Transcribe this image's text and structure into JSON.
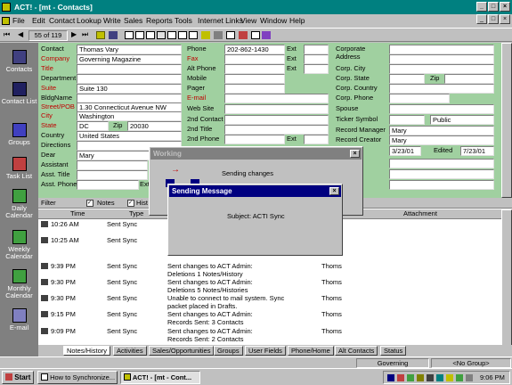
{
  "window": {
    "title": "ACT! - [mt - Contacts]",
    "min": "_",
    "max": "□",
    "close": "×"
  },
  "menu": [
    "File",
    "Edit",
    "Contact",
    "Lookup",
    "Write",
    "Sales",
    "Reports",
    "Tools",
    "Internet Links",
    "View",
    "Window",
    "Help"
  ],
  "toolbar": {
    "record_counter": "55 of 119"
  },
  "sidebar": [
    "Contacts",
    "Contact List",
    "Groups",
    "Task List",
    "Daily Calendar",
    "Weekly Calendar",
    "Monthly Calendar",
    "E-mail"
  ],
  "contact": {
    "labels": {
      "contact": "Contact",
      "company": "Company",
      "title": "Title",
      "department": "Department",
      "suite": "Suite",
      "bldgname": "BldgName",
      "street": "Street/POB",
      "city": "City",
      "state": "State",
      "zip": "Zip",
      "country": "Country",
      "directions": "Directions",
      "dear": "Dear",
      "assistant": "Assistant",
      "asst_title": "Asst. Title",
      "asst_phone": "Asst. Phone",
      "ext": "Ext",
      "phone": "Phone",
      "fax": "Fax",
      "alt_phone": "Alt Phone",
      "mobile": "Mobile",
      "pager": "Pager",
      "email": "E-mail",
      "website": "Web Site",
      "contact2": "2nd Contact",
      "title2": "2nd Title",
      "phone2": "2nd Phone",
      "corporate": "Corporate",
      "address": "Address",
      "corp_city": "Corp. City",
      "corp_state": "Corp. State",
      "corp_zip": "Zip",
      "corp_country": "Corp. Country",
      "corp_phone": "Corp. Phone",
      "spouse": "Spouse",
      "ticker": "Ticker Symbol",
      "record_manager": "Record Manager",
      "record_creator": "Record Creator",
      "edited": "Edited"
    },
    "values": {
      "contact": "Thomas Vary",
      "company": "Governing Magazine",
      "suite": "Suite 130",
      "street": "1.30  Connecticut Avenue NW",
      "city": "Washington",
      "state": "DC",
      "zip": "20030",
      "country": "United States",
      "dear": "Mary",
      "phone": "202-862-1430",
      "ticker_type": "Public",
      "record_manager": "Mary",
      "record_creator": "Mary",
      "create_date": "3/23/01",
      "edited_date": "7/23/01"
    }
  },
  "grid": {
    "filter_label": "Filter",
    "notes_label": "Notes",
    "hist_label": "Hist",
    "columns": [
      "Time",
      "Type",
      "Attachment"
    ],
    "rows": [
      {
        "time": "10:26 AM",
        "type": "Sent Sync",
        "regarding": "",
        "line2": "",
        "user": ""
      },
      {
        "time": "10:25 AM",
        "type": "Sent Sync",
        "regarding": "",
        "line2": "",
        "user": ""
      },
      {
        "time": "9:39 PM",
        "type": "Sent Sync",
        "regarding": "Sent changes to ACT Admin:",
        "line2": "Deletions 1 Notes/History",
        "user": "Thoms"
      },
      {
        "time": "9:30 PM",
        "type": "Sent Sync",
        "regarding": "Sent changes to ACT Admin:",
        "line2": "Deletions 5 Notes/Histories",
        "user": "Thoms"
      },
      {
        "time": "9:30 PM",
        "type": "Sent Sync",
        "regarding": "Unable to connect to mail system. Sync",
        "line2": "packet placed in Drafts.",
        "user": "Thoms"
      },
      {
        "time": "9:15 PM",
        "type": "Sent Sync",
        "regarding": "Sent changes to ACT Admin:",
        "line2": "Records Sent: 3 Contacts",
        "user": "Thoms"
      },
      {
        "time": "9:09 PM",
        "type": "Sent Sync",
        "regarding": "Sent changes to ACT Admin:",
        "line2": "Records Sent: 2 Contacts",
        "user": "Thoms"
      }
    ]
  },
  "tabs": [
    "Notes/History",
    "Activities",
    "Sales/Opportunities",
    "Groups",
    "User Fields",
    "Phone/Home",
    "Alt Contacts",
    "Status"
  ],
  "working_dialog": {
    "title": "Working",
    "message": "Sending changes"
  },
  "sending_dialog": {
    "title": "Sending Message",
    "subject": "Subject: ACTI Sync"
  },
  "statusbar": {
    "group": "Governing",
    "no_group": "<No Group>"
  },
  "taskbar": {
    "start": "Start",
    "task1": "How to Synchronize...",
    "task2": "ACT! - [mt - Cont...",
    "clock": "9:06 PM"
  }
}
